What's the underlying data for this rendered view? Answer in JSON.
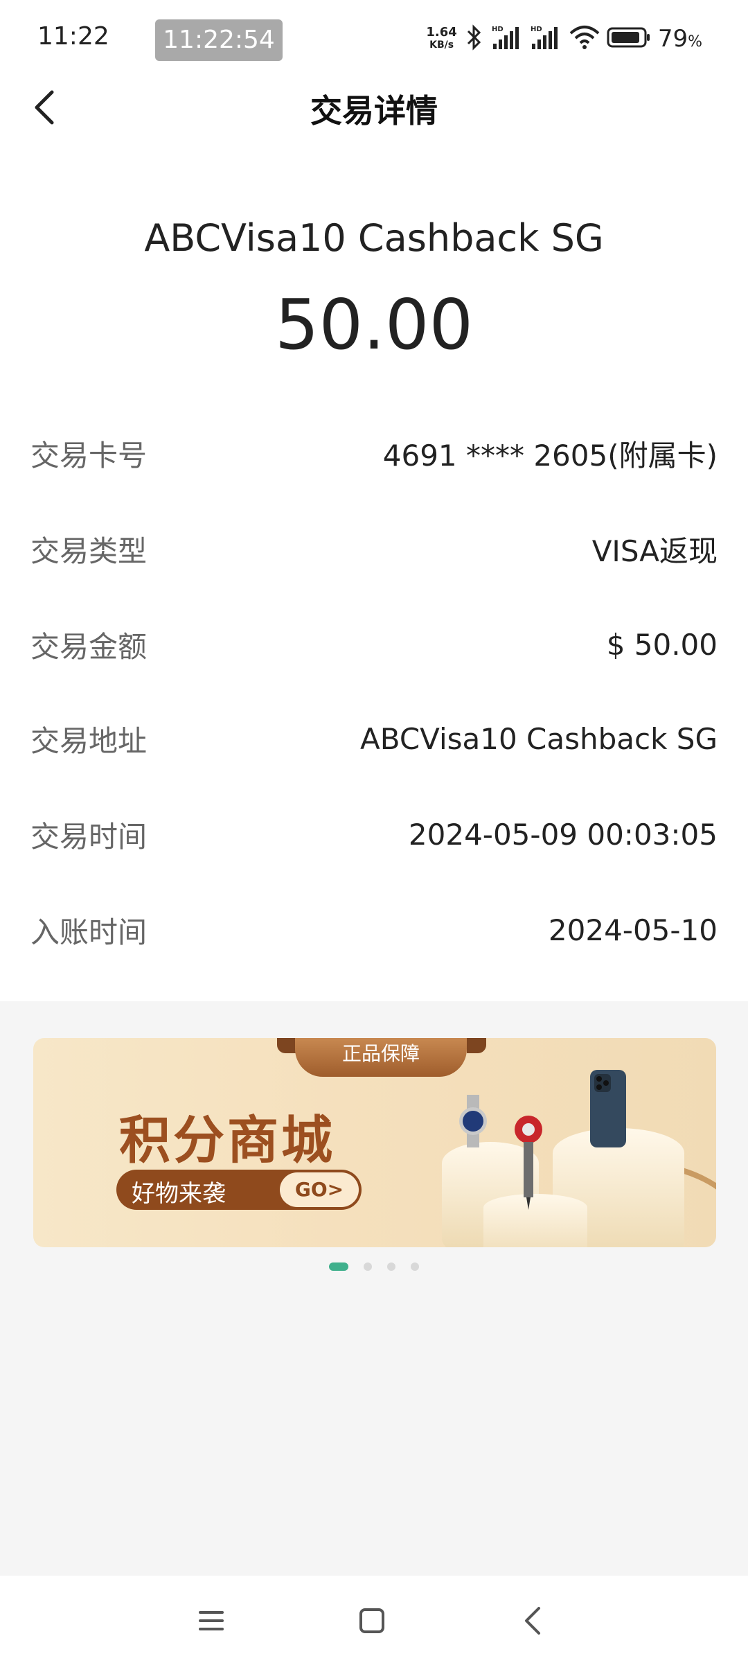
{
  "status_bar": {
    "time": "11:22",
    "chip_time": "11:22:54",
    "net_speed_value": "1.64",
    "net_speed_unit": "KB/s",
    "battery_pct": "79",
    "battery_unit": "%"
  },
  "header": {
    "title": "交易详情"
  },
  "summary": {
    "merchant": "ABCVisa10 Cashback SG",
    "amount": "50.00"
  },
  "details": [
    {
      "label": "交易卡号",
      "value": "4691 **** 2605(附属卡)"
    },
    {
      "label": "交易类型",
      "value": "VISA返现"
    },
    {
      "label": "交易金额",
      "value": "$ 50.00"
    },
    {
      "label": "交易地址",
      "value": "ABCVisa10 Cashback SG"
    },
    {
      "label": "交易时间",
      "value": "2024-05-09 00:03:05"
    },
    {
      "label": "入账时间",
      "value": "2024-05-10"
    }
  ],
  "banner": {
    "ribbon": "正品保障",
    "title": "积分商城",
    "pill_text": "好物来袭",
    "go_label": "GO>",
    "page_count": 4,
    "active_page": 1
  },
  "colors": {
    "accent": "#3fb08c",
    "banner_brown": "#9c4f20",
    "background": "#f5f5f5"
  },
  "icons": [
    "back-chevron-icon",
    "bluetooth-icon",
    "signal-icon",
    "wifi-icon",
    "battery-icon",
    "menu-icon",
    "home-square-icon",
    "back-triangle-icon"
  ]
}
